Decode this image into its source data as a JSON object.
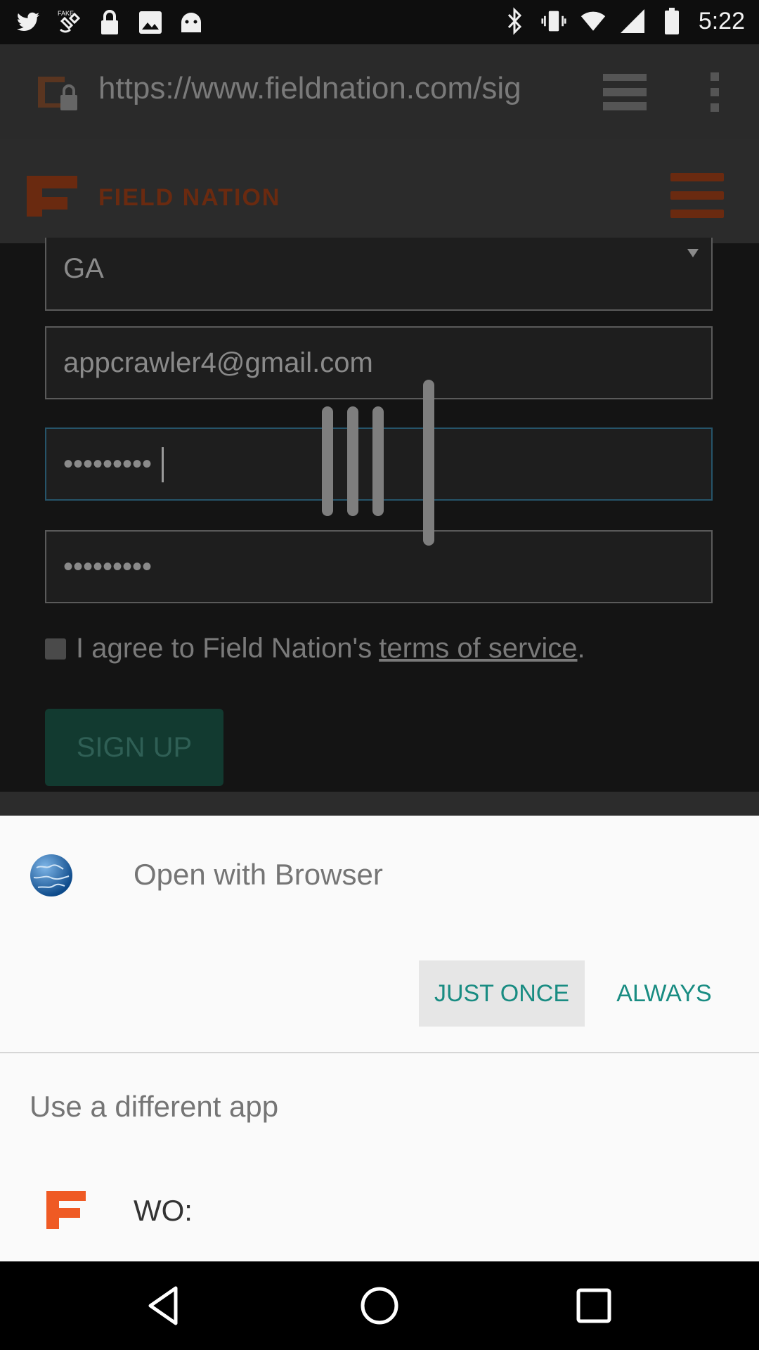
{
  "status_bar": {
    "time": "5:22",
    "left_icons": [
      "twitter-icon",
      "fake-gps-icon",
      "lock-icon",
      "image-icon",
      "android-debug-icon"
    ],
    "right_icons": [
      "bluetooth-icon",
      "vibrate-icon",
      "wifi-icon",
      "signal-icon",
      "battery-icon"
    ]
  },
  "browser": {
    "url": "https://www.fieldnation.com/sig",
    "icons": [
      "secure-page-icon",
      "tabs-icon",
      "overflow-menu-icon"
    ]
  },
  "site": {
    "name": "FIELD NATION",
    "logo_color": "#6a2a10"
  },
  "form": {
    "state_value": "GA",
    "email_value": "appcrawler4@gmail.com",
    "password_value": "•••••••••",
    "confirm_password_value": "•••••••••",
    "agree_text": "I agree to Field Nation's",
    "terms_link": "terms of service",
    "agree_period": ".",
    "signup_label": "SIGN UP"
  },
  "dialog": {
    "title": "Open with Browser",
    "just_once_label": "JUST ONCE",
    "always_label": "ALWAYS",
    "different_app_label": "Use a different app",
    "app_name": "WO:",
    "accent_color": "#198c82"
  },
  "nav": {
    "icons": [
      "back-icon",
      "home-icon",
      "recents-icon"
    ]
  }
}
